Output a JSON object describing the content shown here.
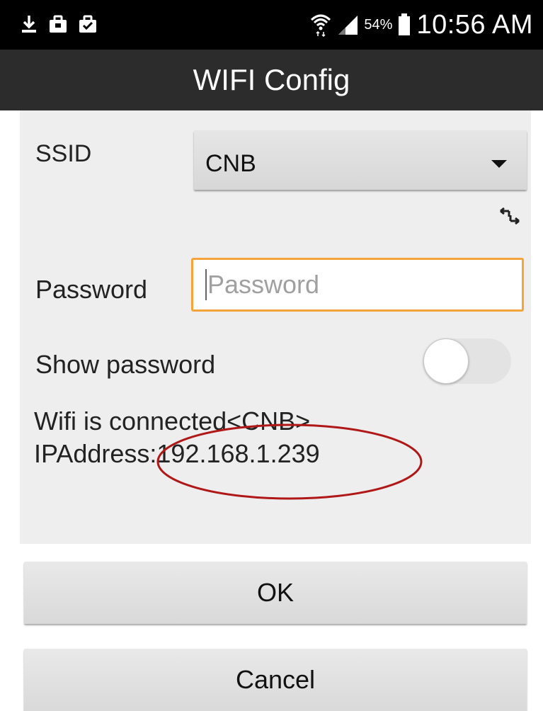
{
  "status_bar": {
    "icons": [
      "download-icon",
      "briefcase-icon",
      "briefcase-check-icon",
      "wifi-icon",
      "signal-icon",
      "battery-icon"
    ],
    "battery_percent": "54%",
    "time": "10:56 AM"
  },
  "title": "WIFI Config",
  "form": {
    "ssid_label": "SSID",
    "ssid_value": "CNB",
    "password_label": "Password",
    "password_placeholder": "Password",
    "password_value": "",
    "show_password_label": "Show password",
    "show_password_on": false,
    "status_line1": "Wifi is connected<CNB>",
    "status_line2": "IPAddress:192.168.1.239"
  },
  "buttons": {
    "ok": "OK",
    "cancel": "Cancel"
  },
  "colors": {
    "input_focus": "#f5a33a",
    "annotation": "#b01818",
    "title_bar": "#2c2c2c"
  }
}
